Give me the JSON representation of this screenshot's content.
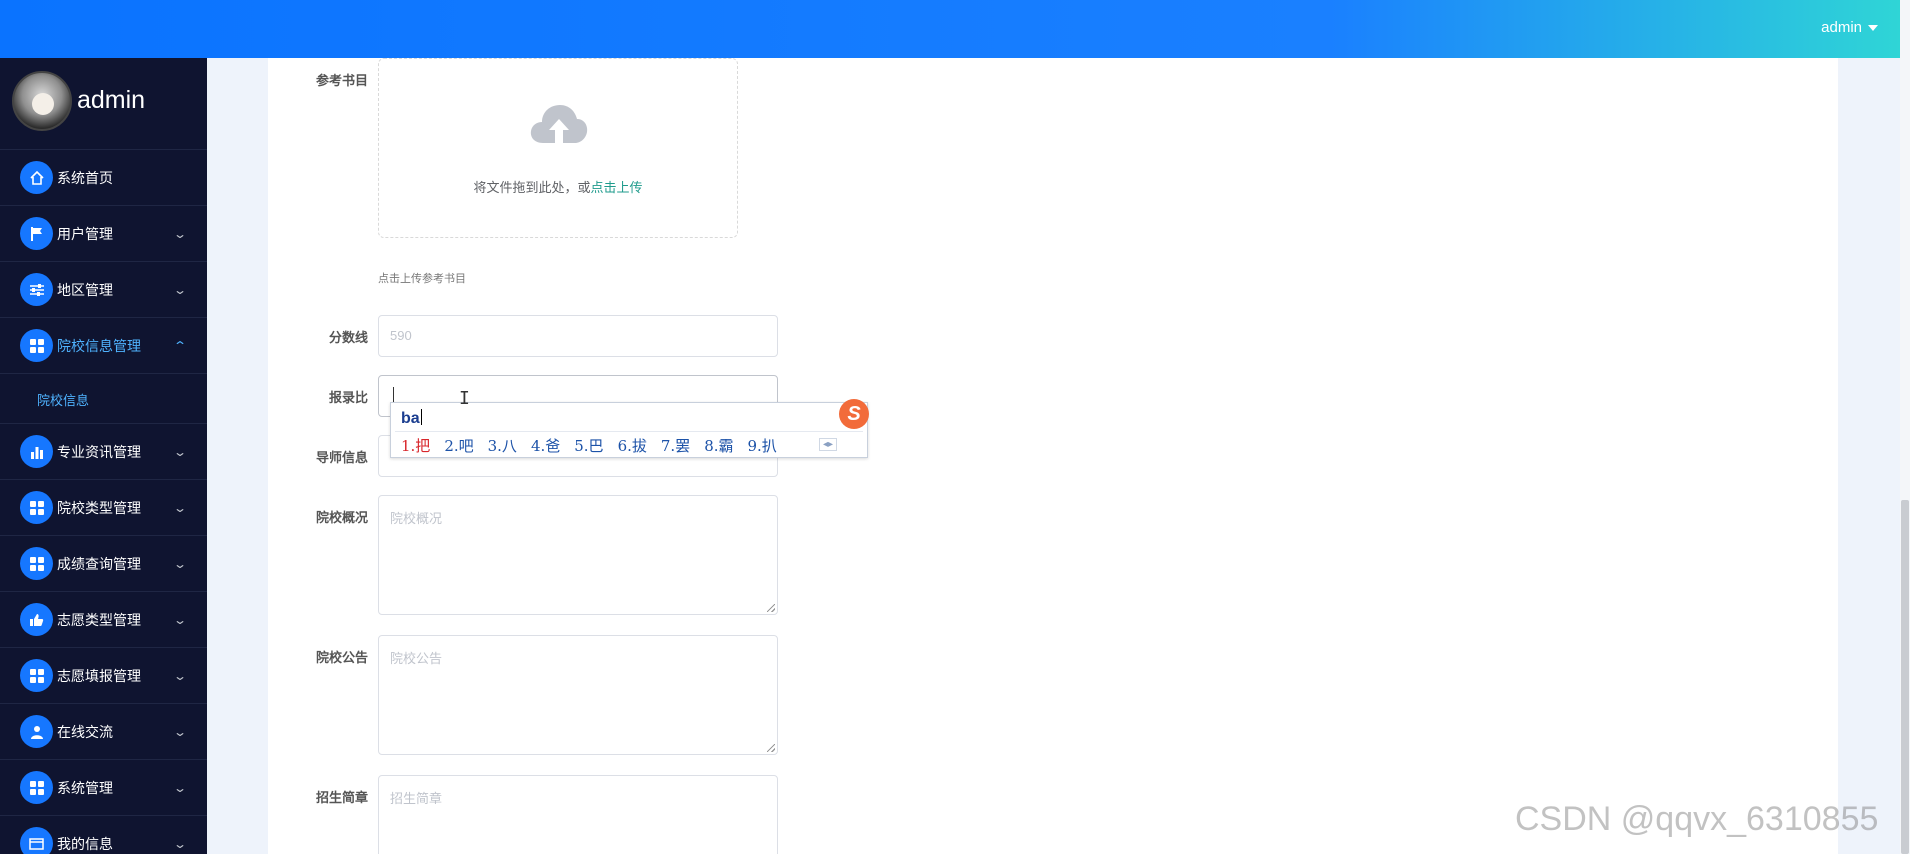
{
  "header": {
    "user": "admin"
  },
  "sidebar": {
    "username": "admin",
    "items": [
      {
        "label": "系统首页",
        "icon": "home-icon",
        "arrow": ""
      },
      {
        "label": "用户管理",
        "icon": "flag-icon",
        "arrow": "⌄"
      },
      {
        "label": "地区管理",
        "icon": "sliders-icon",
        "arrow": "⌄"
      },
      {
        "label": "院校信息管理",
        "icon": "grid-icon",
        "arrow": "⌃"
      },
      {
        "label": "专业资讯管理",
        "icon": "bar-chart-icon",
        "arrow": "⌄"
      },
      {
        "label": "院校类型管理",
        "icon": "grid-icon",
        "arrow": "⌄"
      },
      {
        "label": "成绩查询管理",
        "icon": "grid-icon",
        "arrow": "⌄"
      },
      {
        "label": "志愿类型管理",
        "icon": "thumb-icon",
        "arrow": "⌄"
      },
      {
        "label": "志愿填报管理",
        "icon": "grid-icon",
        "arrow": "⌄"
      },
      {
        "label": "在线交流",
        "icon": "person-icon",
        "arrow": "⌄"
      },
      {
        "label": "系统管理",
        "icon": "grid-icon",
        "arrow": "⌄"
      },
      {
        "label": "我的信息",
        "icon": "card-icon",
        "arrow": "⌄"
      }
    ],
    "submenu": "院校信息"
  },
  "form": {
    "ref_books_label": "参考书目",
    "upload_hint": "将文件拖到此处，或",
    "upload_link": "点击上传",
    "upload_tip": "点击上传参考书目",
    "score_label": "分数线",
    "score_value": "590",
    "ratio_label": "报录比",
    "tutor_label": "导师信息",
    "overview_label": "院校概况",
    "overview_placeholder": "院校概况",
    "notice_label": "院校公告",
    "notice_placeholder": "院校公告",
    "brochure_label": "招生简章",
    "brochure_placeholder": "招生简章"
  },
  "ime": {
    "composition": "ba",
    "candidates": [
      "1.把",
      "2.吧",
      "3.八",
      "4.爸",
      "5.巴",
      "6.拔",
      "7.罢",
      "8.霸",
      "9.扒"
    ],
    "pager": "◂▸",
    "logo": "S"
  },
  "watermark": "CSDN @qqvx_6310855"
}
